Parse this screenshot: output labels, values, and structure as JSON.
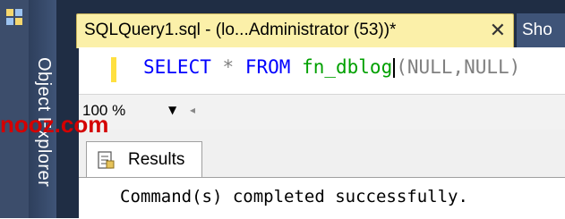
{
  "side_panel": {
    "label": "Object Explorer"
  },
  "tabs": {
    "active_title": "SQLQuery1.sql - (lo...Administrator (53))*",
    "close_glyph": "✕",
    "second_title": "Sho"
  },
  "editor": {
    "keyword": "SELECT",
    "operator": "*",
    "keyword2": "FROM",
    "function": "fn_dblog",
    "args": "(NULL,NULL)"
  },
  "zoom": {
    "value": "100 %"
  },
  "results": {
    "tab_label": "Results",
    "message": "Command(s) completed successfully."
  },
  "watermark": {
    "text": "nooz.com"
  },
  "colors": {
    "tab_active": "#fbf0a9",
    "sql_keyword": "#0000ff",
    "sql_function": "#00a000",
    "watermark": "#d40000"
  }
}
